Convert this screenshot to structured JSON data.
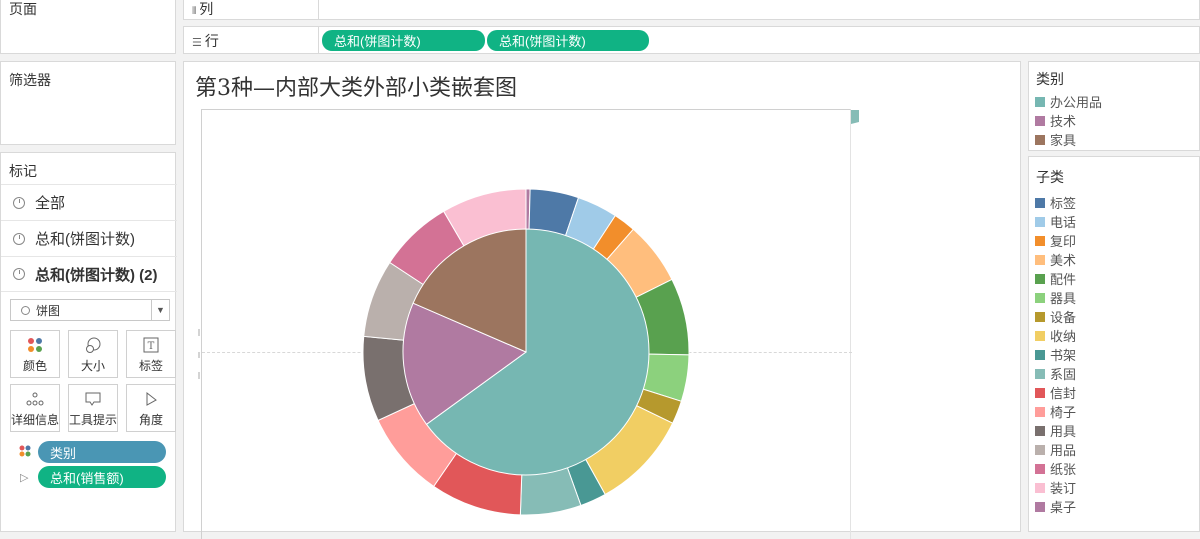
{
  "shelves": {
    "pages_label": "页面",
    "columns_label": "列",
    "rows_label": "行",
    "row_pills": [
      "总和(饼图计数)",
      "总和(饼图计数)"
    ]
  },
  "filters": {
    "label": "筛选器"
  },
  "marks": {
    "label": "标记",
    "rows": [
      "全部",
      "总和(饼图计数)",
      "总和(饼图计数) (2)"
    ],
    "mark_type": "饼图",
    "cards": [
      "颜色",
      "大小",
      "标签",
      "详细信息",
      "工具提示",
      "角度"
    ],
    "pills": [
      {
        "label": "类别",
        "color": "#4a96b4"
      },
      {
        "label": "总和(销售额)",
        "color": "#10b384"
      }
    ]
  },
  "viz": {
    "title": "第3种—内部大类外部小类嵌套图"
  },
  "legend_category": {
    "title": "类别",
    "items": [
      {
        "label": "办公用品",
        "color": "#76b7b2"
      },
      {
        "label": "技术",
        "color": "#b07aa1"
      },
      {
        "label": "家具",
        "color": "#9c755f"
      }
    ]
  },
  "legend_subcategory": {
    "title": "子类",
    "items": [
      {
        "label": "标签",
        "color": "#4e79a7"
      },
      {
        "label": "电话",
        "color": "#a0cbe8"
      },
      {
        "label": "复印",
        "color": "#f28e2b"
      },
      {
        "label": "美术",
        "color": "#ffbe7d"
      },
      {
        "label": "配件",
        "color": "#59a14f"
      },
      {
        "label": "器具",
        "color": "#8cd17d"
      },
      {
        "label": "设备",
        "color": "#b6992d"
      },
      {
        "label": "收纳",
        "color": "#f1ce63"
      },
      {
        "label": "书架",
        "color": "#499894"
      },
      {
        "label": "系固",
        "color": "#86bcb6"
      },
      {
        "label": "信封",
        "color": "#e15759"
      },
      {
        "label": "椅子",
        "color": "#ff9d9a"
      },
      {
        "label": "用具",
        "color": "#79706e"
      },
      {
        "label": "用品",
        "color": "#bab0ac"
      },
      {
        "label": "纸张",
        "color": "#d37295"
      },
      {
        "label": "装订",
        "color": "#fabfd2"
      },
      {
        "label": "桌子",
        "color": "#b07aa1"
      }
    ]
  },
  "chart_data": {
    "type": "pie",
    "title": "第3种—内部大类外部小类嵌套图",
    "inner": [
      {
        "name": "办公用品",
        "value": 65.0,
        "color": "#76b7b2"
      },
      {
        "name": "技术",
        "value": 16.5,
        "color": "#b07aa1"
      },
      {
        "name": "家具",
        "value": 18.5,
        "color": "#9c755f"
      }
    ],
    "outer": [
      {
        "name": "桌子",
        "value": 0.4,
        "color": "#b07aa1"
      },
      {
        "name": "标签",
        "value": 4.8,
        "color": "#4e79a7"
      },
      {
        "name": "电话",
        "value": 4.0,
        "color": "#a0cbe8"
      },
      {
        "name": "复印",
        "value": 2.2,
        "color": "#f28e2b"
      },
      {
        "name": "美术",
        "value": 6.2,
        "color": "#ffbe7d"
      },
      {
        "name": "配件",
        "value": 7.6,
        "color": "#59a14f"
      },
      {
        "name": "器具",
        "value": 4.6,
        "color": "#8cd17d"
      },
      {
        "name": "设备",
        "value": 2.3,
        "color": "#b6992d"
      },
      {
        "name": "收纳",
        "value": 9.7,
        "color": "#f1ce63"
      },
      {
        "name": "书架",
        "value": 2.6,
        "color": "#499894"
      },
      {
        "name": "系固",
        "value": 6.0,
        "color": "#86bcb6"
      },
      {
        "name": "信封",
        "value": 9.0,
        "color": "#e15759"
      },
      {
        "name": "椅子",
        "value": 8.5,
        "color": "#ff9d9a"
      },
      {
        "name": "用具",
        "value": 8.4,
        "color": "#79706e"
      },
      {
        "name": "用品",
        "value": 7.7,
        "color": "#bab0ac"
      },
      {
        "name": "纸张",
        "value": 7.3,
        "color": "#d37295"
      },
      {
        "name": "装订",
        "value": 8.4,
        "color": "#fabfd2"
      }
    ]
  }
}
